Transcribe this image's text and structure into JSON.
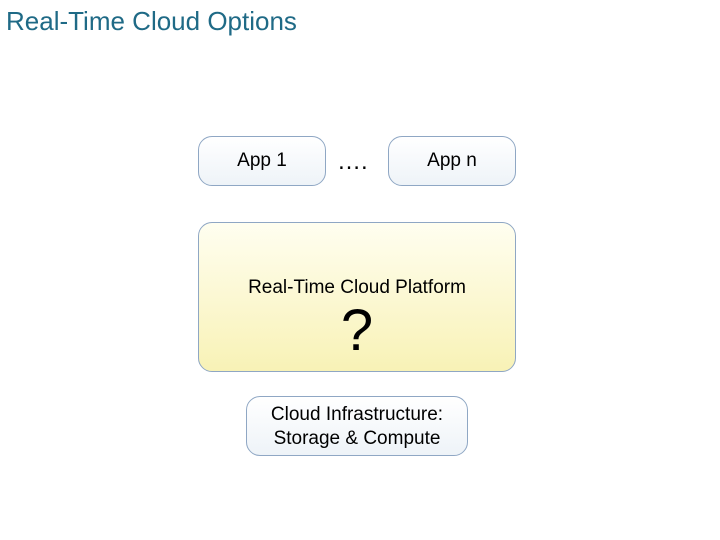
{
  "title": "Real-Time Cloud Options",
  "apps": {
    "first": "App 1",
    "dots": "….",
    "last": "App n"
  },
  "platform": {
    "label": "Real-Time Cloud Platform",
    "mark": "?"
  },
  "infra": {
    "line1": "Cloud Infrastructure:",
    "line2": "Storage & Compute"
  }
}
